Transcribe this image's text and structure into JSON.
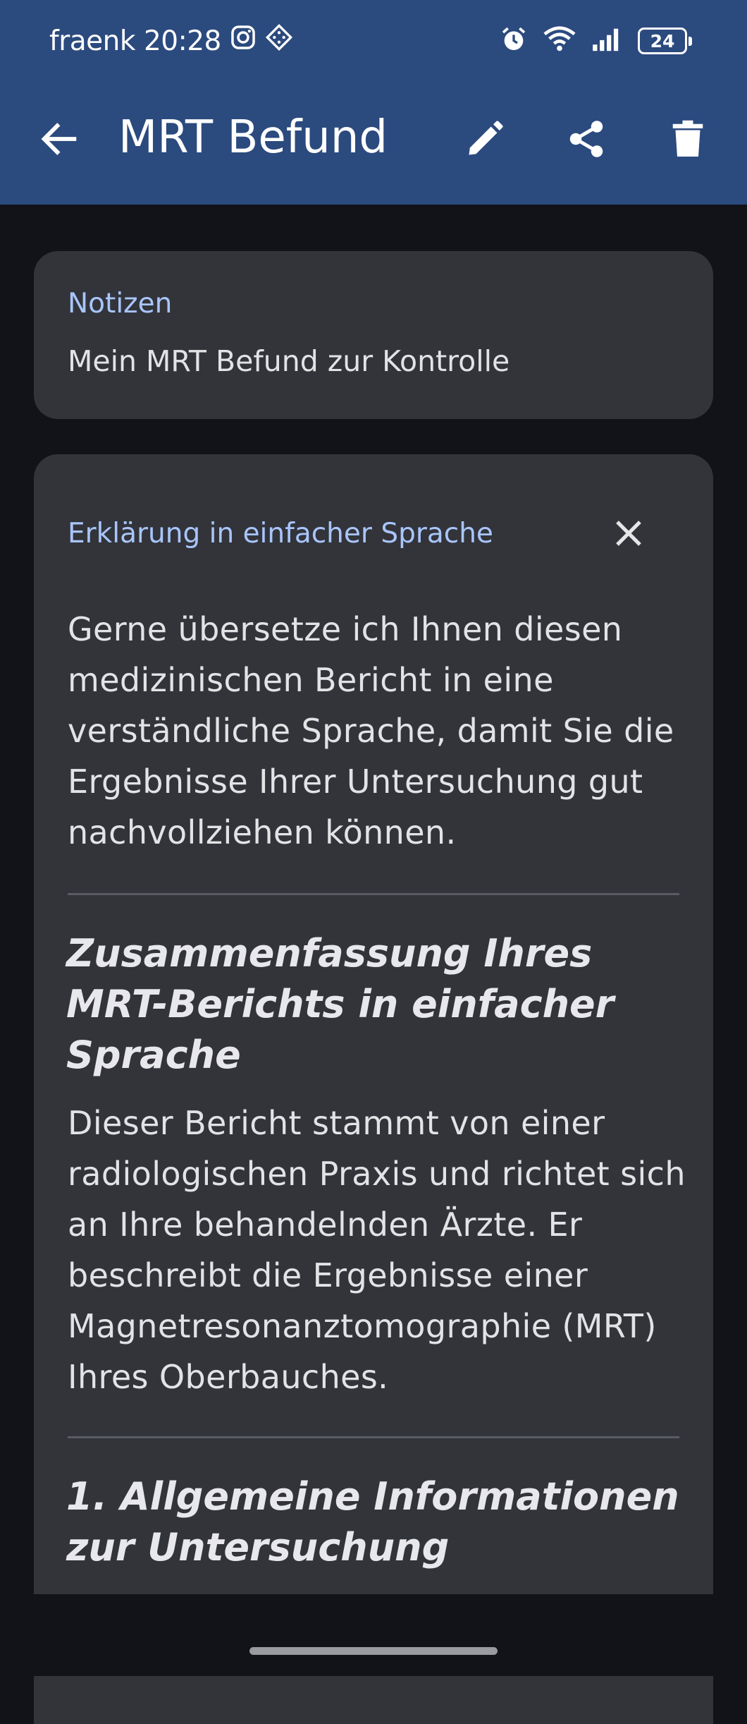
{
  "status_bar": {
    "carrier": "fraenk",
    "time": "20:28",
    "battery": "24"
  },
  "app_bar": {
    "title": "MRT Befund"
  },
  "notes_card": {
    "label": "Notizen",
    "text": "Mein MRT Befund zur Kontrolle"
  },
  "explanation_card": {
    "label": "Erklärung in einfacher Sprache",
    "intro": "Gerne übersetze ich Ihnen diesen medizinischen Bericht in eine verständliche Sprache, damit Sie die Ergebnisse Ihrer Untersuchung gut nachvollziehen können.",
    "heading1": "Zusammenfassung Ihres MRT-Berichts in einfacher Sprache",
    "paragraph1": "Dieser Bericht stammt von einer radiologischen Praxis und richtet sich an Ihre behandelnden Ärzte. Er beschreibt die Ergebnisse einer Magnetresonanztomographie (MRT) Ihres Oberbauches.",
    "heading2": "1. Allgemeine Informationen zur Untersuchung"
  },
  "colors": {
    "app_bar": "#2b4a7e",
    "background": "#121318",
    "card": "#32343a",
    "accent_label": "#a9c5fb"
  },
  "icons": [
    "instagram-icon",
    "app-notification-icon",
    "alarm-icon",
    "wifi-icon",
    "signal-icon",
    "battery-icon",
    "back-arrow-icon",
    "edit-pencil-icon",
    "share-icon",
    "delete-trash-icon",
    "close-icon"
  ]
}
